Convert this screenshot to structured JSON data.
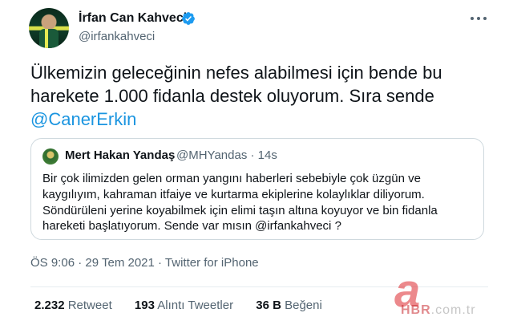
{
  "author": {
    "display_name": "İrfan Can Kahveci",
    "handle": "@irfankahveci",
    "verified_icon": "verified-badge-icon"
  },
  "tweet": {
    "text_part1": "Ülkemizin geleceğinin nefes alabilmesi için bende bu harekete 1.000 fidanla destek oluyorum. Sıra sende ",
    "mention": "@CanerErkin"
  },
  "quoted_tweet": {
    "display_name": "Mert Hakan Yandaş",
    "handle_time": "@MHYandas · 14s",
    "text_part1": "Bir çok ilimizden gelen orman yangını haberleri sebebiyle çok üzgün ve kaygılıyım, kahraman itfaiye ve kurtarma ekiplerine kolaylıklar diliyorum. Söndürüleni yerine koyabilmek için elimi taşın altına koyuyor ve bin fidanla hareketi başlatıyorum. Sende var mısın ",
    "mention": "@irfankahveci",
    "text_part2": " ?"
  },
  "meta": {
    "time": "ÖS 9:06",
    "date": "29 Tem 2021",
    "source": "Twitter for iPhone",
    "separator": " · "
  },
  "stats": {
    "retweets_count": "2.232",
    "retweets_label": "Retweet",
    "quotes_count": "193",
    "quotes_label": "Alıntı Tweetler",
    "likes_count": "36 B",
    "likes_label": "Beğeni"
  },
  "watermark": {
    "logo_letter": "a",
    "brand": "HBR",
    "domain_suffix": ".com.tr"
  },
  "colors": {
    "link": "#1b95e0",
    "verified": "#1d9bf0",
    "muted_text": "#536471"
  }
}
